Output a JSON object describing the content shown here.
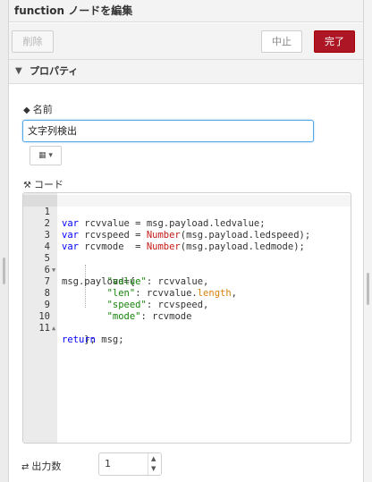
{
  "tray": {
    "title": "function ノードを編集"
  },
  "toolbar": {
    "delete_label": "削除",
    "cancel_label": "中止",
    "done_label": "完了"
  },
  "properties": {
    "header": "プロパティ",
    "name_label": "名前",
    "name_value": "文字列検出",
    "code_label": "コード",
    "outputs_label": "出力数",
    "outputs_value": "1"
  },
  "icons": {
    "tag": "tag-icon",
    "wrench": "wrench-icon",
    "book": "book-icon",
    "shuffle": "shuffle-icon",
    "chevron": "chevron-down-icon"
  },
  "colors": {
    "done_button": "#ad1625",
    "input_focus": "#52a7e6"
  },
  "editor": {
    "line_numbers": [
      "1",
      "2",
      "3",
      "4",
      "5",
      "6",
      "7",
      "8",
      "9",
      "10",
      "11"
    ],
    "lines": [
      "var rcvvalue = msg.payload.ledvalue;",
      "var rcvspeed = Number(msg.payload.ledspeed);",
      "var rcvmode  = Number(msg.payload.ledmode);",
      "",
      "msg.payload={",
      "        \"value\": rcvvalue,",
      "        \"len\": rcvvalue.length,",
      "        \"speed\": rcvspeed,",
      "        \"mode\": rcvmode",
      "    };",
      "return msg;"
    ]
  }
}
